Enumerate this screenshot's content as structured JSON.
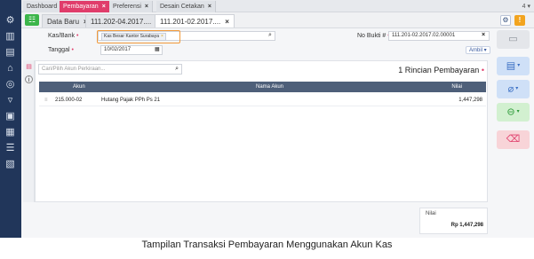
{
  "top_tabs": [
    {
      "label": "Dashboard",
      "closable": false,
      "active": false
    },
    {
      "label": "Pembayaran",
      "closable": true,
      "active": true
    },
    {
      "label": "Preferensi",
      "closable": true,
      "active": false
    },
    {
      "label": "Desain Cetakan",
      "closable": true,
      "active": false
    }
  ],
  "top_counter": "4",
  "sub_tabs": [
    {
      "label": "Data Baru",
      "active": false
    },
    {
      "label": "111.202-04.2017....",
      "active": false
    },
    {
      "label": "111.201-02.2017....",
      "active": true
    }
  ],
  "form": {
    "kas_bank_label": "Kas/Bank",
    "kas_bank_value": "Kas Besar Kantor Surabaya",
    "tanggal_label": "Tanggal",
    "tanggal_value": "10/02/2017",
    "no_bukti_label": "No Bukti #",
    "no_bukti_value": "111.201-02.2017.02.00001",
    "ambil_label": "Ambil"
  },
  "detail": {
    "search_placeholder": "Cari/Pilih Akun Perkiraan...",
    "title": "1 Rincian Pembayaran",
    "columns": [
      "Akun",
      "Nama Akun",
      "Nilai"
    ],
    "rows": [
      {
        "akun": "215.000-02",
        "nama": "Hutang Pajak PPh Ps 21",
        "nilai": "1,447,298"
      }
    ]
  },
  "total": {
    "label": "Nilai",
    "value": "Rp 1,447,298"
  },
  "caption": "Tampilan Transaksi Pembayaran Menggunakan Akun Kas",
  "colors": {
    "sidebar": "#21365a",
    "active_tab": "#e03d6b",
    "highlight_box": "#f29a3a",
    "grid_header": "#4e5f79"
  }
}
